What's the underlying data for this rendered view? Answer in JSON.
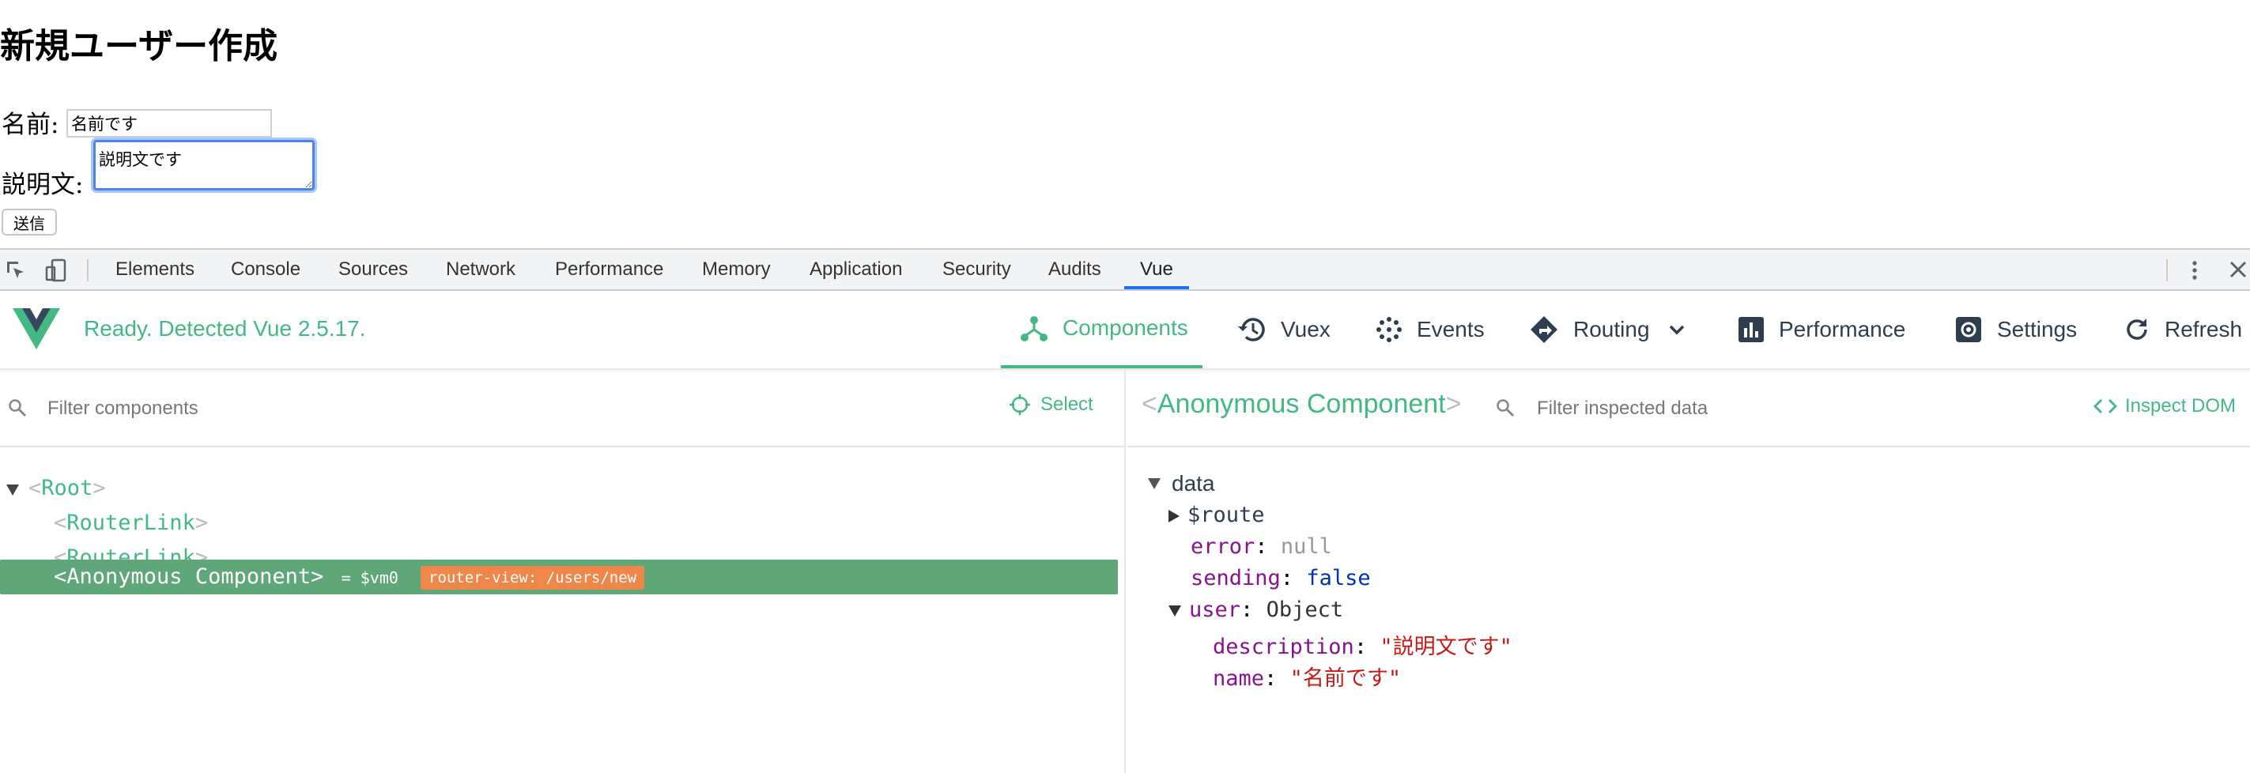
{
  "page": {
    "title": "新規ユーザー作成",
    "name_label": "名前:",
    "name_value": "名前です",
    "description_label": "説明文:",
    "description_value": "説明文です",
    "submit_label": "送信"
  },
  "devtools": {
    "tabs": [
      "Elements",
      "Console",
      "Sources",
      "Network",
      "Performance",
      "Memory",
      "Application",
      "Security",
      "Audits",
      "Vue"
    ],
    "active_tab": "Vue"
  },
  "vue": {
    "status": "Ready. Detected Vue 2.5.17.",
    "tabs": {
      "components": "Components",
      "vuex": "Vuex",
      "events": "Events",
      "routing": "Routing",
      "performance": "Performance",
      "settings": "Settings",
      "refresh": "Refresh"
    },
    "active_tab": "Components",
    "accent_color": "#42b983",
    "left": {
      "filter_placeholder": "Filter components",
      "select_label": "Select",
      "tree": [
        {
          "open": "<",
          "name": "Root",
          "close": ">",
          "expanded": true
        },
        {
          "open": "<",
          "name": "RouterLink",
          "close": ">"
        },
        {
          "open": "<",
          "name": "RouterLink",
          "close": ">"
        },
        {
          "open": "<",
          "name": "Anonymous Component",
          "close": ">",
          "selected": true,
          "vm": "= $vm0",
          "badge": "router-view: /users/new"
        }
      ]
    },
    "right": {
      "open": "<",
      "title": "Anonymous Component",
      "close": ">",
      "filter_placeholder": "Filter inspected data",
      "inspect_dom": "Inspect DOM",
      "section": "data",
      "props": {
        "route_key": "$route",
        "error_key": "error",
        "error_val": "null",
        "sending_key": "sending",
        "sending_val": "false",
        "user_key": "user",
        "user_val": "Object",
        "description_key": "description",
        "description_val": "\"説明文です\"",
        "name_key": "name",
        "name_val": "\"名前です\""
      },
      "colon": ":"
    }
  }
}
